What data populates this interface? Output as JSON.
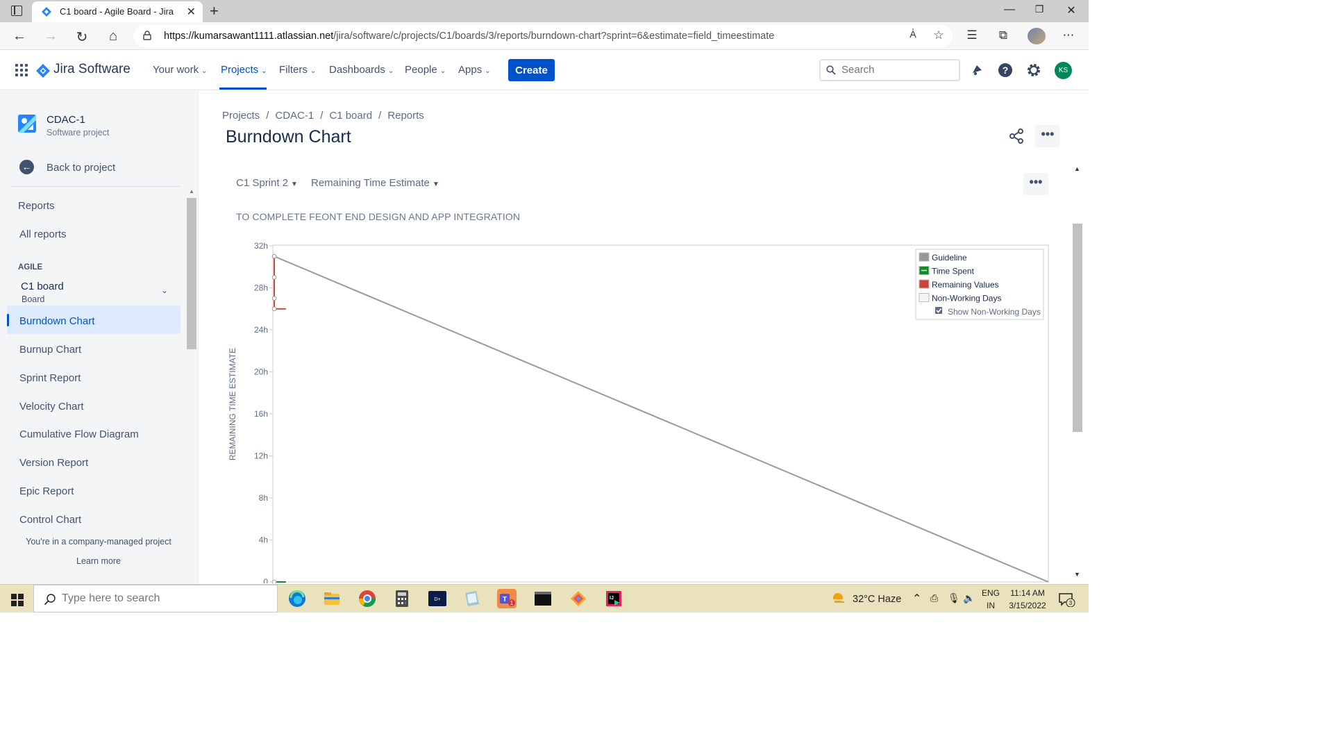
{
  "browser": {
    "tab_title": "C1 board - Agile Board - Jira",
    "url_host": "https://kumarsawant1111.atlassian.net",
    "url_path": "/jira/software/c/projects/C1/boards/3/reports/burndown-chart?sprint=6&estimate=field_timeestimate"
  },
  "topnav": {
    "product": "Jira Software",
    "items": [
      "Your work",
      "Projects",
      "Filters",
      "Dashboards",
      "People",
      "Apps"
    ],
    "active": "Projects",
    "create_label": "Create",
    "search_placeholder": "Search",
    "avatar_initials": "KS"
  },
  "sidebar": {
    "project_name": "CDAC-1",
    "project_type": "Software project",
    "back_label": "Back to project",
    "reports_heading": "Reports",
    "all_reports": "All reports",
    "section_label": "AGILE",
    "board_name": "C1 board",
    "board_sub": "Board",
    "items": [
      "Burndown Chart",
      "Burnup Chart",
      "Sprint Report",
      "Velocity Chart",
      "Cumulative Flow Diagram",
      "Version Report",
      "Epic Report",
      "Control Chart"
    ],
    "active_item": "Burndown Chart",
    "footer_text": "You're in a company-managed project",
    "footer_link": "Learn more"
  },
  "main": {
    "breadcrumbs": [
      "Projects",
      "CDAC-1",
      "C1 board",
      "Reports"
    ],
    "title": "Burndown Chart",
    "sprint_select": "C1 Sprint 2",
    "estimate_select": "Remaining Time Estimate",
    "sprint_goal": "TO COMPLETE FEONT END DESIGN AND APP INTEGRATION"
  },
  "chart_data": {
    "type": "line",
    "title": "",
    "ylabel": "REMAINING TIME ESTIMATE",
    "y_ticks": [
      "32h",
      "28h",
      "24h",
      "20h",
      "16h",
      "12h",
      "8h",
      "4h",
      "0"
    ],
    "ylim": [
      0,
      32
    ],
    "grid": false,
    "legend": {
      "placement": "top-right",
      "entries": [
        {
          "label": "Guideline",
          "color": "#999999"
        },
        {
          "label": "Time Spent",
          "color": "#14892c"
        },
        {
          "label": "Remaining Values",
          "color": "#d04437"
        },
        {
          "label": "Non-Working Days",
          "color": "#f5f5f5"
        }
      ],
      "checkbox_label": "Show Non-Working Days",
      "checkbox_checked": true
    },
    "series": [
      {
        "name": "Guideline",
        "x": [
          0,
          1
        ],
        "y": [
          31,
          0
        ]
      },
      {
        "name": "Remaining Values",
        "x": [
          0,
          0,
          0,
          0,
          0.015
        ],
        "y": [
          31,
          29,
          27,
          26,
          26
        ]
      },
      {
        "name": "Time Spent",
        "x": [
          0,
          0.015
        ],
        "y": [
          0,
          0
        ]
      }
    ]
  },
  "taskbar": {
    "search_placeholder": "Type here to search",
    "weather": "32°C  Haze",
    "lang_top": "ENG",
    "lang_bottom": "IN",
    "time": "11:14 AM",
    "date": "3/15/2022",
    "notification_count": "3"
  }
}
